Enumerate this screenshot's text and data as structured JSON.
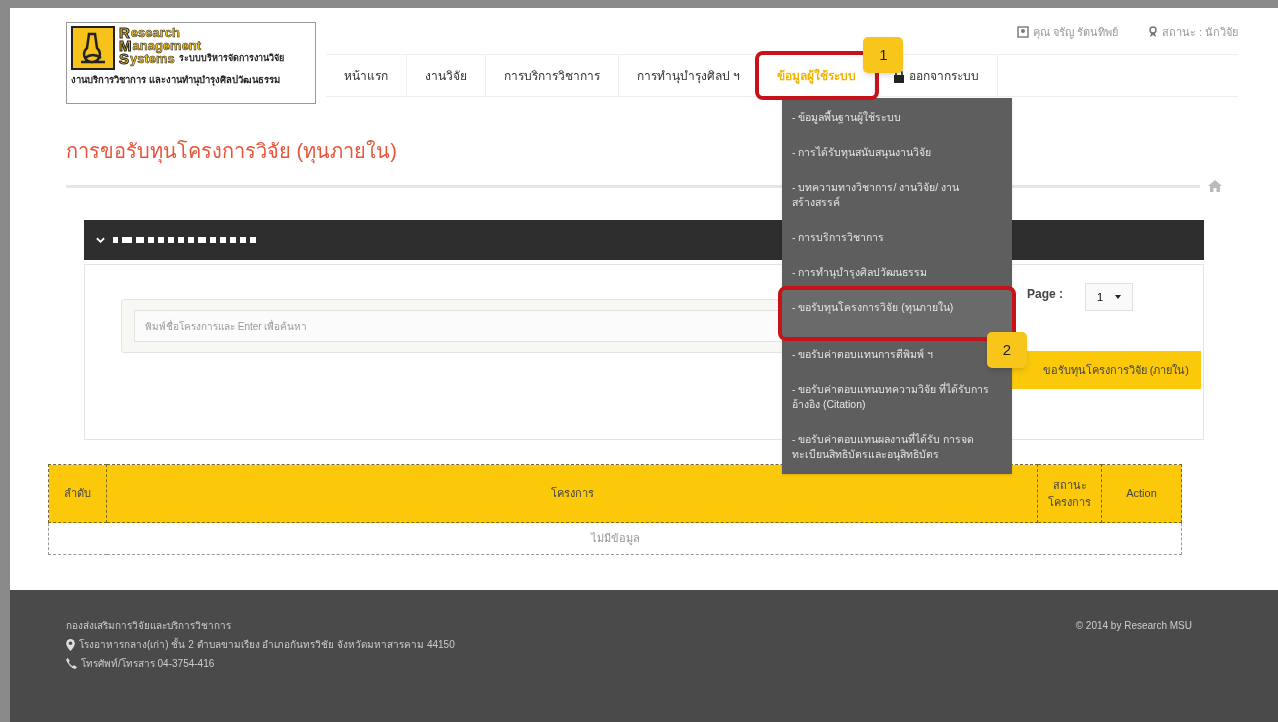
{
  "logo": {
    "initials": [
      "R",
      "M",
      "S"
    ],
    "words": [
      "esearch",
      "anagement",
      "ystems"
    ],
    "tagline": "ระบบบริหารจัดการงานวิจัย",
    "subtitle": "งานบริการวิชาการ และงานทำนุบำรุงศิลปวัฒนธรรม"
  },
  "user": {
    "name": "คุณ จรัญ รัตนทิพย์",
    "status": "สถานะ : นักวิจัย"
  },
  "nav": [
    {
      "label": "หน้าแรก",
      "selected": false,
      "kind": "link"
    },
    {
      "label": "งานวิจัย",
      "selected": false,
      "kind": "link"
    },
    {
      "label": "การบริการวิชาการ",
      "selected": false,
      "kind": "link"
    },
    {
      "label": "การทำนุบำรุงศิลป ฯ",
      "selected": false,
      "kind": "link"
    },
    {
      "label": "ข้อมูลผู้ใช้ระบบ",
      "selected": true,
      "kind": "link"
    },
    {
      "label": "ออกจากระบบ",
      "selected": false,
      "kind": "logout"
    }
  ],
  "menu": [
    {
      "label": "- ข้อมูลพื้นฐานผู้ใช้ระบบ",
      "selected": false
    },
    {
      "label": "- การได้รับทุนสนับสนุนงานวิจัย",
      "selected": false
    },
    {
      "label": "- บทความทางวิชาการ/ งานวิจัย/ งานสร้างสรรค์",
      "selected": false
    },
    {
      "label": "- การบริการวิชาการ",
      "selected": false
    },
    {
      "label": "- การทำนุบำรุงศิลปวัฒนธรรม",
      "selected": false
    },
    {
      "label": "- ขอรับทุนโครงการวิจัย (ทุนภายใน)",
      "selected": true
    },
    {
      "label": "- ขอรับค่าตอบแทนการตีพิมพ์ ฯ",
      "selected": false
    },
    {
      "label": "- ขอรับค่าตอบแทนบทความวิจัย ที่ได้รับการอ้างอิง (Citation)",
      "selected": false
    },
    {
      "label": "- ขอรับค่าตอบแทนผลงานที่ได้รับ การจดทะเบียนสิทธิบัตรและอนุสิทธิบัตร",
      "selected": false
    }
  ],
  "callouts": [
    "1",
    "2"
  ],
  "page_title": "การขอรับทุนโครงการวิจัย (ทุนภายใน)",
  "search": {
    "placeholder": "พิมพ์ชื่อโครงการและ Enter เพื่อค้นหา"
  },
  "pager": {
    "label": "Page :",
    "value": "1"
  },
  "add_button": "ขอรับทุนโครงการวิจัย (ภายใน)",
  "table": {
    "columns": [
      "ลำดับ",
      "โครงการ",
      "สถานะ โครงการ",
      "Action"
    ],
    "empty": "ไม่มีข้อมูล"
  },
  "footer": {
    "org": "กองส่งเสริมการวิจัยและบริการวิชาการ",
    "address": "โรงอาหารกลาง(เก่า) ชั้น 2 ตำบลขามเรียง อำเภอกันทรวิชัย จังหวัดมหาสารคาม 44150",
    "phone": "โทรศัพท์/โทรสาร 04-3754-416",
    "copyright": "© 2014 by Research MSU"
  }
}
